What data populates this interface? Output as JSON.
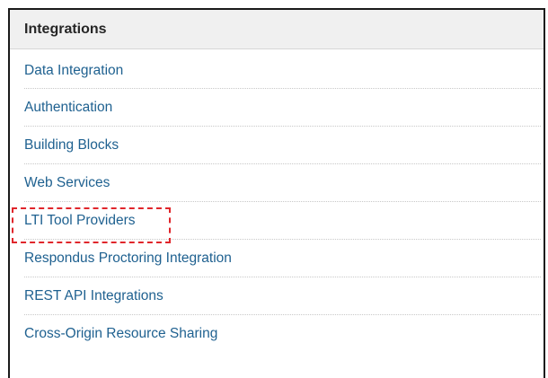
{
  "panel": {
    "title": "Integrations"
  },
  "links": [
    {
      "label": "Data Integration"
    },
    {
      "label": "Authentication"
    },
    {
      "label": "Building Blocks"
    },
    {
      "label": "Web Services"
    },
    {
      "label": "LTI Tool Providers",
      "highlighted": true
    },
    {
      "label": "Respondus Proctoring Integration"
    },
    {
      "label": "REST API Integrations"
    },
    {
      "label": "Cross-Origin Resource Sharing"
    }
  ],
  "colors": {
    "link": "#1f6190",
    "header_bg": "#f0f0f0",
    "highlight": "#e0262b"
  }
}
